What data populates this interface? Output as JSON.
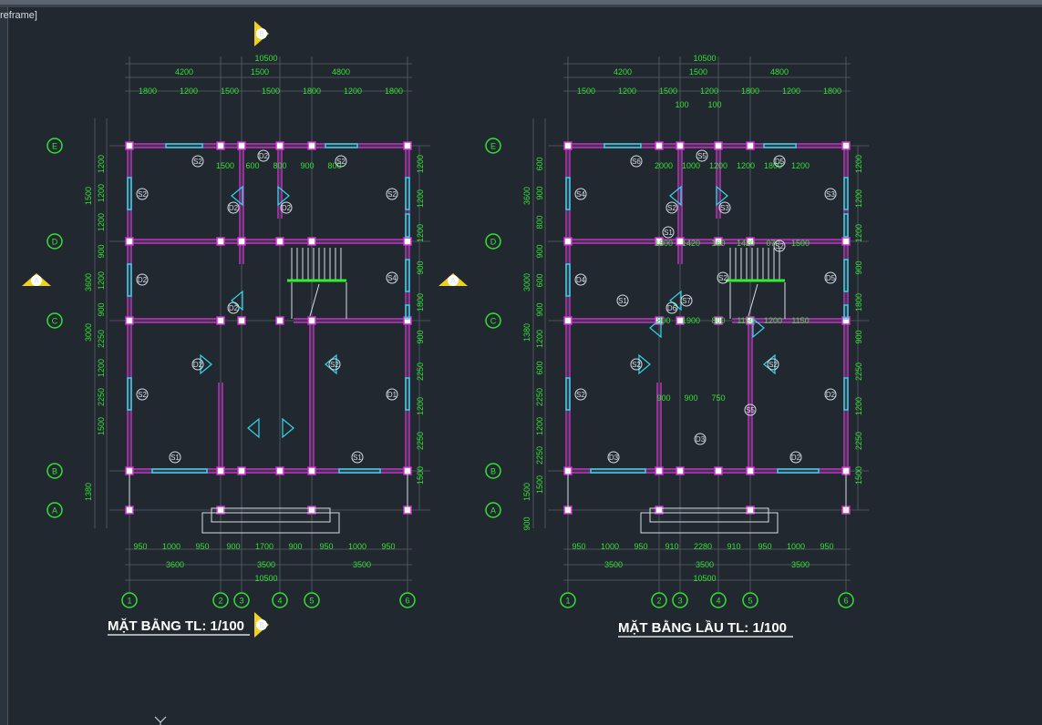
{
  "viewport_label": "reframe]",
  "colors": {
    "background": "#212830",
    "wall": "#d02ed0",
    "dim": "#35e035",
    "window": "#30d8e8",
    "grid": "#5c6168",
    "marker": "#f0d020"
  },
  "titles": {
    "left": "MẶT BẰNG TL: 1/100",
    "right": "MẶT BẰNG LẦU TL: 1/100"
  },
  "markers": {
    "top_b": "B",
    "mid_a": "A",
    "mid_a2": "A",
    "bot_b": "B"
  },
  "left_plan": {
    "dims_top_total": "10500",
    "dims_top_mid": [
      "4200",
      "1500",
      "4800"
    ],
    "dims_top_inner": [
      "1800",
      "1200",
      "1500",
      "1500",
      "1800",
      "1200",
      "1800"
    ],
    "dims_left_outer": [
      "1500",
      "3600",
      "3000",
      "1380"
    ],
    "dims_left_inner": [
      "1200",
      "1200",
      "1200",
      "900",
      "1200",
      "900",
      "2250",
      "1200",
      "2250",
      "1500"
    ],
    "dims_right": [
      "1200",
      "1200",
      "1200",
      "900",
      "1800",
      "900",
      "2250",
      "1200",
      "2250",
      "1500"
    ],
    "dims_bottom_inner": [
      "950",
      "1000",
      "950",
      "900",
      "1700",
      "900",
      "950",
      "1000",
      "950"
    ],
    "dims_bottom_mid": [
      "3600",
      "3500",
      "3500"
    ],
    "dims_bottom_total": "10500",
    "inner_dims": [
      "1500",
      "600",
      "800",
      "900",
      "800"
    ],
    "axes_x": [
      "1",
      "2",
      "3",
      "4",
      "5",
      "6"
    ],
    "axes_y": [
      "E",
      "D",
      "C",
      "B",
      "A"
    ],
    "tags": [
      "S2",
      "D2",
      "S2",
      "S2",
      "D2",
      "D2",
      "S2",
      "S4",
      "D2",
      "D2",
      "D2",
      "S2",
      "S2",
      "D1",
      "S1",
      "S1"
    ]
  },
  "right_plan": {
    "dims_top_total": "10500",
    "dims_top_mid": [
      "4200",
      "1500",
      "4800"
    ],
    "dims_top_inner": [
      "1500",
      "1200",
      "1500",
      "1200",
      "1800",
      "1200",
      "1800"
    ],
    "dims_top_extra": [
      "100",
      "100"
    ],
    "dims_left_outer": [
      "3600",
      "3000",
      "1380",
      "1500",
      "900"
    ],
    "dims_left_inner": [
      "600",
      "900",
      "800",
      "900",
      "600",
      "900",
      "1200",
      "600",
      "2250",
      "1200",
      "2250",
      "1500"
    ],
    "dims_right": [
      "1200",
      "1200",
      "1200",
      "900",
      "1800",
      "900",
      "2250",
      "1200",
      "2250",
      "1500"
    ],
    "dims_bottom_inner": [
      "950",
      "1000",
      "950",
      "910",
      "2280",
      "910",
      "950",
      "1000",
      "950"
    ],
    "dims_bottom_mid": [
      "3500",
      "3500",
      "3500"
    ],
    "dims_bottom_total": "10500",
    "inner_dims": [
      "2000",
      "1000",
      "1200",
      "1200",
      "1800",
      "1200",
      "1800",
      "1420",
      "160",
      "1420",
      "070",
      "1500",
      "800",
      "1900",
      "800",
      "1150",
      "1200",
      "1150",
      "900",
      "900",
      "750"
    ],
    "axes_x": [
      "1",
      "2",
      "3",
      "4",
      "5",
      "6"
    ],
    "axes_y": [
      "E",
      "D",
      "C",
      "B",
      "A"
    ],
    "tags": [
      "S6",
      "S5",
      "D5",
      "S4",
      "S2",
      "S3",
      "S3",
      "D5",
      "D4",
      "D6",
      "S2",
      "S2",
      "S2",
      "D2",
      "D3",
      "D2",
      "D3",
      "S2",
      "S2",
      "S1",
      "S7",
      "S1",
      "S5"
    ]
  }
}
